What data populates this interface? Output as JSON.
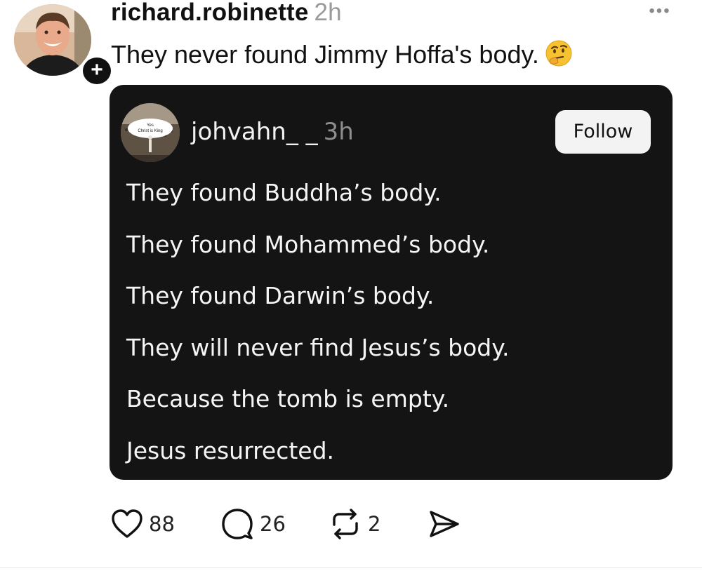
{
  "post": {
    "username": "richard.robinette",
    "time": "2h",
    "text": "They never found Jimmy Hoffa's body.",
    "emoji_icon": "thinking-face-emoji",
    "more_icon": "more-horizontal-icon",
    "more_glyph": "•••",
    "follow_plus_glyph": "+"
  },
  "quoted_post": {
    "username": "johvahn_ _",
    "time": "3h",
    "avatar_text": [
      "Yes",
      "Christ is King"
    ],
    "follow_label": "Follow",
    "lines": [
      "They found Buddha’s body.",
      "They found Mohammed’s body.",
      "They found Darwin’s body.",
      "They will never find Jesus’s body.",
      "Because the tomb is empty.",
      "Jesus resurrected."
    ]
  },
  "actions": {
    "likes": "88",
    "replies": "26",
    "reposts": "2"
  },
  "colors": {
    "quote_bg": "#141414",
    "timestamp": "#9a9a9a",
    "follow_btn_bg": "#f3f3f3"
  }
}
